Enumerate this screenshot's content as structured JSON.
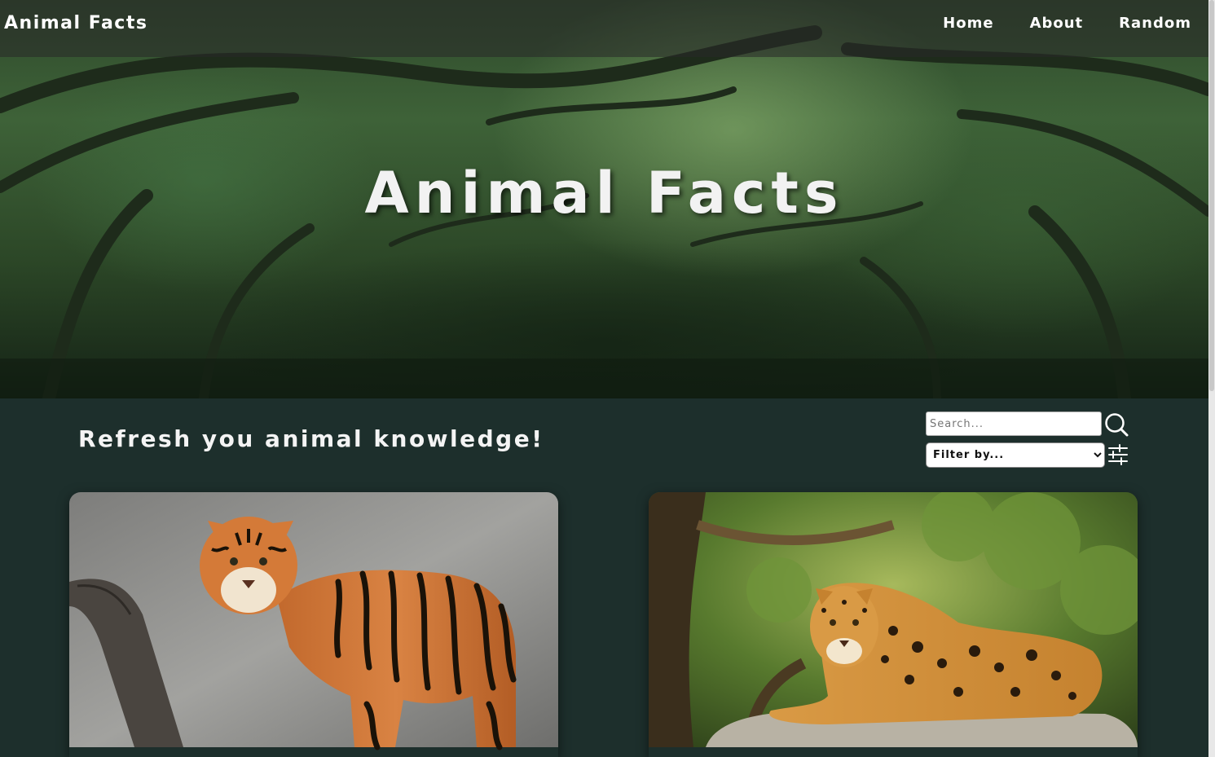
{
  "nav": {
    "brand": "Animal Facts",
    "links": [
      "Home",
      "About",
      "Random"
    ]
  },
  "hero": {
    "title": "Animal Facts"
  },
  "main": {
    "tagline": "Refresh you animal knowledge!",
    "search": {
      "placeholder": "Search...",
      "value": ""
    },
    "filter": {
      "selected": "Filter by..."
    }
  },
  "cards": [
    {
      "image": "tiger-photo"
    },
    {
      "image": "jaguar-photo"
    }
  ],
  "colors": {
    "background": "#1d2f2c",
    "navbar": "#282828",
    "text": "#ffffff"
  },
  "icons": [
    "search-icon",
    "filter-sliders-icon"
  ]
}
